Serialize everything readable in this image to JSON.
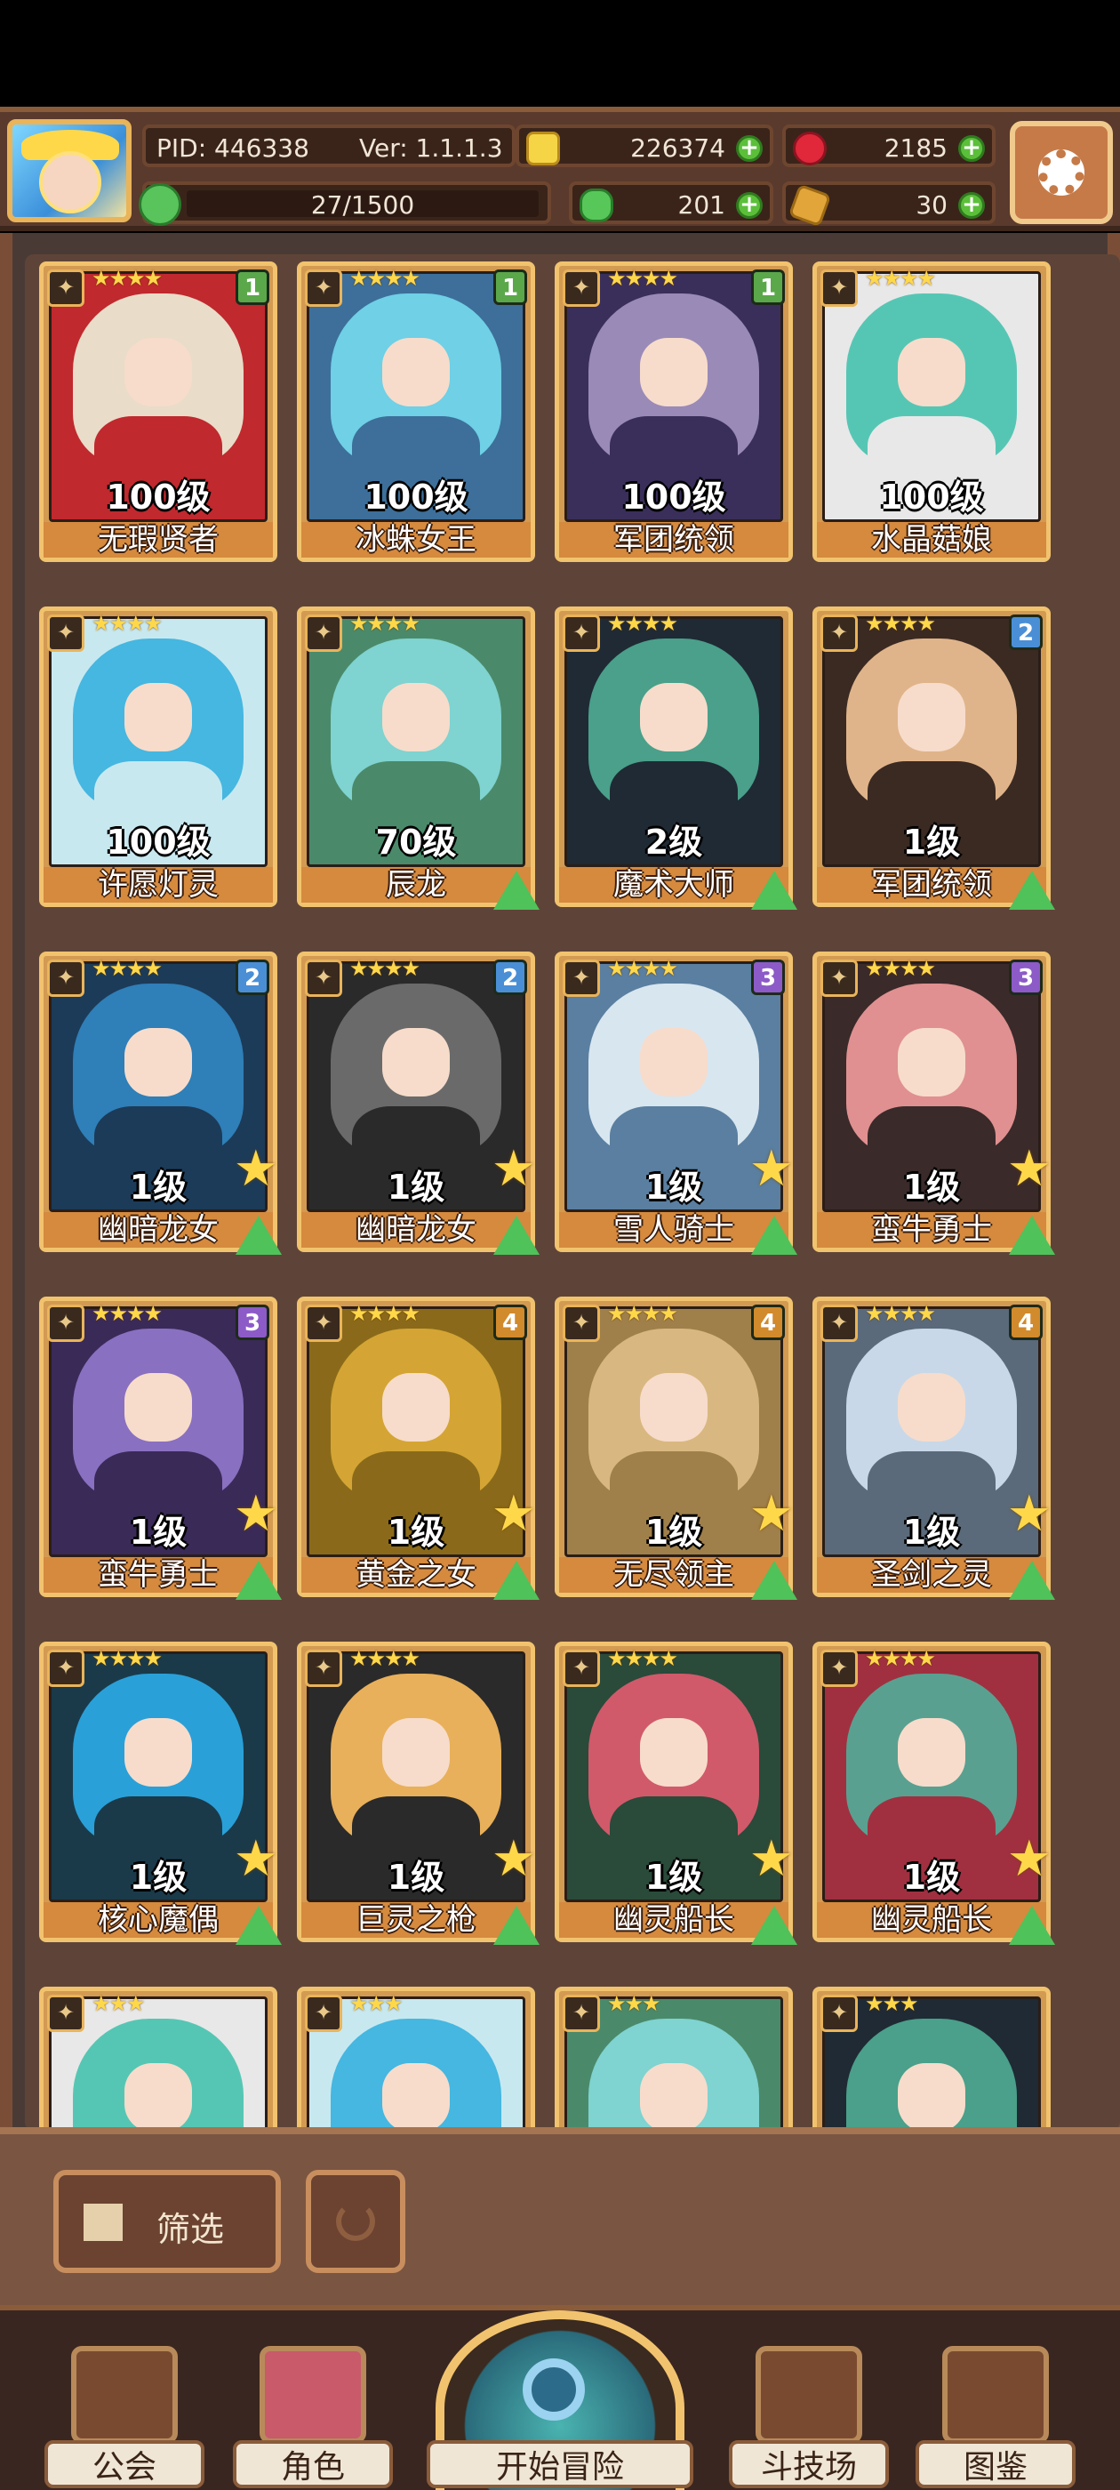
{
  "header": {
    "pid": "PID: 446338",
    "version": "Ver: 1.1.1.3",
    "coins": "226374",
    "gems": "2185",
    "stamina": "27/1500",
    "clover": "201",
    "keys": "30"
  },
  "cards": [
    {
      "name": "无瑕贤者",
      "level": "100级",
      "badge": "1"
    },
    {
      "name": "冰蛛女王",
      "level": "100级",
      "badge": "1"
    },
    {
      "name": "军团统领",
      "level": "100级",
      "badge": "1"
    },
    {
      "name": "水晶菇娘",
      "level": "100级",
      "badge": ""
    },
    {
      "name": "许愿灯灵",
      "level": "100级",
      "badge": ""
    },
    {
      "name": "辰龙",
      "level": "70级",
      "badge": ""
    },
    {
      "name": "魔术大师",
      "level": "2级",
      "badge": ""
    },
    {
      "name": "军团统领",
      "level": "1级",
      "badge": "2"
    },
    {
      "name": "幽暗龙女",
      "level": "1级",
      "badge": "2"
    },
    {
      "name": "幽暗龙女",
      "level": "1级",
      "badge": "2"
    },
    {
      "name": "雪人骑士",
      "level": "1级",
      "badge": "3"
    },
    {
      "name": "蛮牛勇士",
      "level": "1级",
      "badge": "3"
    },
    {
      "name": "蛮牛勇士",
      "level": "1级",
      "badge": "3"
    },
    {
      "name": "黄金之女",
      "level": "1级",
      "badge": "4"
    },
    {
      "name": "无尽领主",
      "level": "1级",
      "badge": "4"
    },
    {
      "name": "圣剑之灵",
      "level": "1级",
      "badge": "4"
    },
    {
      "name": "核心魔偶",
      "level": "1级",
      "badge": ""
    },
    {
      "name": "巨灵之枪",
      "level": "1级",
      "badge": ""
    },
    {
      "name": "幽灵船长",
      "level": "1级",
      "badge": ""
    },
    {
      "name": "幽灵船长",
      "level": "1级",
      "badge": ""
    }
  ],
  "filter": {
    "label": "筛选"
  },
  "nav": {
    "guild": "公会",
    "character": "角色",
    "adventure": "开始冒险",
    "arena": "斗技场",
    "codex": "图鉴"
  }
}
